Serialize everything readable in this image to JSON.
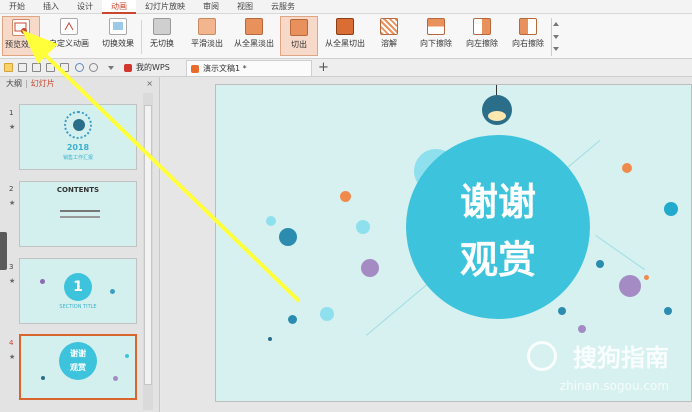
{
  "menu": {
    "tabs": [
      "开始",
      "插入",
      "设计",
      "动画",
      "幻灯片放映",
      "审阅",
      "视图",
      "云服务"
    ],
    "active_index": 3
  },
  "ribbon": {
    "preview": "预览效果",
    "custom_anim": "自定义动画",
    "switch_effect": "切换效果",
    "transitions": [
      "无切换",
      "平滑淡出",
      "从全黑淡出",
      "切出",
      "从全黑切出",
      "溶解",
      "向下擦除",
      "向左擦除",
      "向右擦除"
    ],
    "selected_transition": "切出"
  },
  "doc_tabs": {
    "home": "我的WPS",
    "current": "演示文稿1 *",
    "add": "+"
  },
  "left_pane": {
    "outline": "大纲",
    "slides": "幻灯片",
    "close": "×",
    "thumbs": [
      {
        "num": "1",
        "title": "2018",
        "subtitle": "销售工作汇报"
      },
      {
        "num": "2",
        "title": "CONTENTS"
      },
      {
        "num": "3",
        "title": "1",
        "subtitle": "SECTION TITLE"
      },
      {
        "num": "4",
        "title": "谢谢",
        "subtitle": "观赏"
      }
    ]
  },
  "slide": {
    "line1": "谢谢",
    "line2": "观赏"
  },
  "watermark": {
    "brand": "搜狗指南",
    "url": "zhinan.sogou.com"
  },
  "colors": {
    "accent": "#c9472e",
    "slide_bg": "#d6f1ef",
    "circle": "#3dc3dc",
    "arrow": "#ffff3a"
  }
}
